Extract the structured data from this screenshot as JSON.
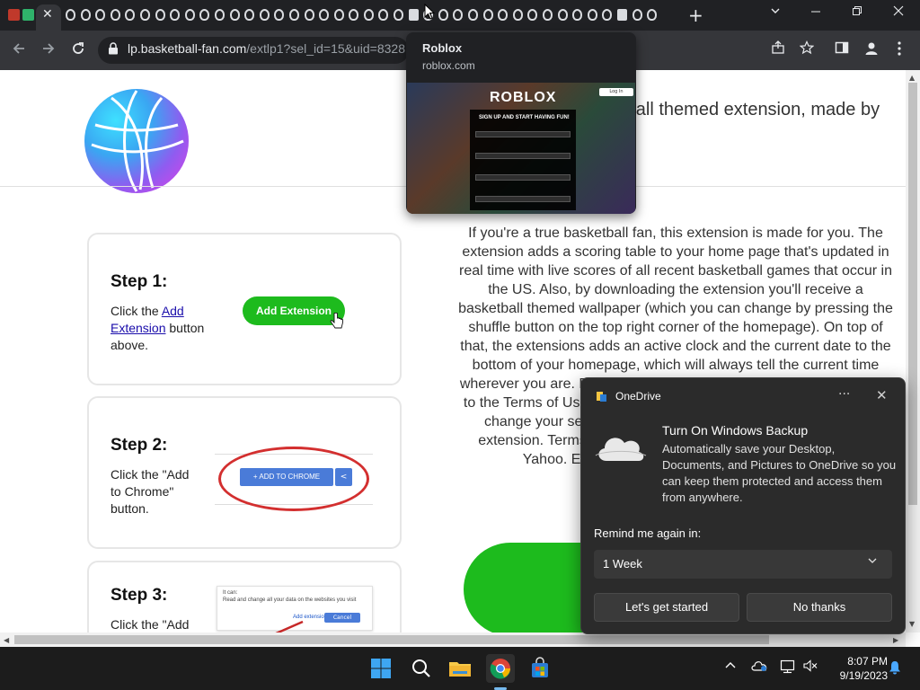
{
  "browser": {
    "active_tab_close": "✕",
    "new_tab": "+",
    "tab_list_chevron": "⌄",
    "url_host": "lp.basketball-fan.com",
    "url_rest": "/extlp1?sel_id=15&uid=8328",
    "mini_tab_count": 40
  },
  "page": {
    "header_text": "ketball themed extension, made by",
    "step1": {
      "title": "Step 1:",
      "desc_prefix": "Click the ",
      "desc_link": "Add Extension",
      "desc_suffix": " button above.",
      "button": "Add Extension"
    },
    "step2": {
      "title": "Step 2:",
      "desc": "Click the \"Add to Chrome\" button.",
      "chrome_button": "ADD TO CHROME"
    },
    "step3": {
      "title": "Step 3:",
      "desc": "Click the \"Add",
      "dialog_title": "It can:",
      "dialog_text": "Read and change all your data on the websites you visit",
      "dialog_add": "Add extension",
      "dialog_cancel": "Cancel"
    },
    "paragraph": "If you're a true basketball fan, this extension is made for you. The extension adds a scoring table to your home page that's updated in real time with live scores of all recent basketball games that occur in the US. Also, by downloading the extension you'll receive a basketball themed wallpaper (which you can change by pressing the shuffle button on the top right corner of the homepage). On top of that, the extensions adds an active clock and the current date to the bottom of your homepage, which will always tell the current time wherever you are. By installing the extension, you accept and agree to the Terms of Use and Privacy Policy. This Chrome extension will change your search provider to the one that provided by this extension. Terms of Use. The search result will be powered by Yahoo. Extension is an independent application."
  },
  "hovercard": {
    "title": "Roblox",
    "domain": "roblox.com",
    "preview_logo": "ROBLOX",
    "preview_login": "Log In",
    "preview_signup": "SIGN UP AND START HAVING FUN!"
  },
  "onedrive": {
    "app_name": "OneDrive",
    "more": "···",
    "close": "✕",
    "title": "Turn On Windows Backup",
    "body": "Automatically save your Desktop, Documents, and Pictures to OneDrive so you can keep them protected and access them from anywhere.",
    "remind_label": "Remind me again in:",
    "remind_value": "1 Week",
    "primary_button": "Let's get started",
    "secondary_button": "No thanks"
  },
  "taskbar": {
    "time": "8:07 PM",
    "date": "9/19/2023"
  },
  "colors": {
    "accent_green": "#1dbb1d",
    "chrome_dark": "#202124",
    "toolbar": "#35363a"
  }
}
